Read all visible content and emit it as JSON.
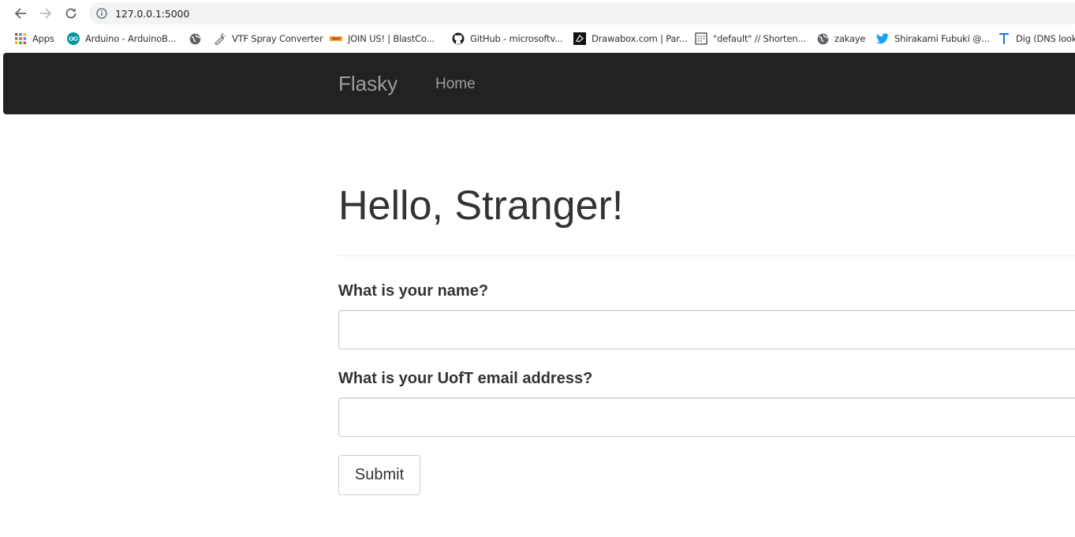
{
  "browser": {
    "url": "127.0.0.1:5000",
    "bookmarks": [
      {
        "label": "Apps",
        "icon": "apps-grid-icon"
      },
      {
        "label": "Arduino - ArduinoB...",
        "icon": "arduino-icon"
      },
      {
        "label": "",
        "icon": "globe-icon"
      },
      {
        "label": "VTF Spray Converter",
        "icon": "spray-icon"
      },
      {
        "label": "JOIN US! | BlastCo...",
        "icon": "blastco-icon"
      },
      {
        "label": "GitHub - microsoftv...",
        "icon": "github-icon"
      },
      {
        "label": "Drawabox.com | Par...",
        "icon": "drawabox-icon"
      },
      {
        "label": "\"default\" // Shorten...",
        "icon": "page-icon"
      },
      {
        "label": "zakaye",
        "icon": "globe-icon"
      },
      {
        "label": "Shirakami Fubuki @...",
        "icon": "twitter-icon"
      },
      {
        "label": "Dig (DNS look",
        "icon": "t-letter-icon"
      }
    ]
  },
  "navbar": {
    "brand": "Flasky",
    "home": "Home"
  },
  "page": {
    "title": "Hello, Stranger!",
    "form": {
      "name_label": "What is your name?",
      "name_value": "",
      "email_label": "What is your UofT email address?",
      "email_value": "",
      "submit_label": "Submit"
    }
  }
}
